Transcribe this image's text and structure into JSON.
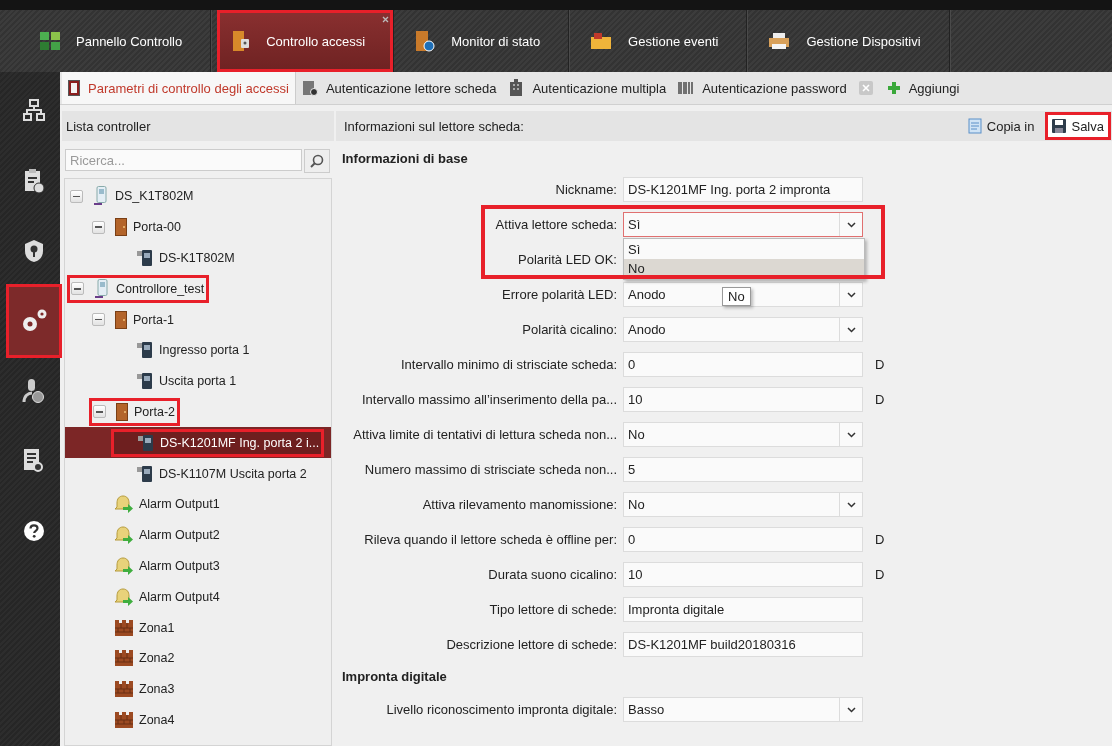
{
  "top_tabs": [
    {
      "label": "Pannello Controllo",
      "kind": "dashboard",
      "selected": false,
      "highlighted": false
    },
    {
      "label": "Controllo accessi",
      "kind": "access",
      "selected": true,
      "highlighted": true
    },
    {
      "label": "Monitor di stato",
      "kind": "monitor",
      "selected": false,
      "highlighted": false
    },
    {
      "label": "Gestione eventi",
      "kind": "events",
      "selected": false,
      "highlighted": false
    },
    {
      "label": "Gestione Dispositivi",
      "kind": "devices",
      "selected": false,
      "highlighted": false
    }
  ],
  "side_rail": [
    {
      "kind": "network",
      "selected": false,
      "highlighted": false
    },
    {
      "kind": "schedule",
      "selected": false,
      "highlighted": false
    },
    {
      "kind": "shield",
      "selected": false,
      "highlighted": false
    },
    {
      "kind": "settings",
      "selected": true,
      "highlighted": true
    },
    {
      "kind": "person",
      "selected": false,
      "highlighted": false
    },
    {
      "kind": "report",
      "selected": false,
      "highlighted": false
    },
    {
      "kind": "help",
      "selected": false,
      "highlighted": false
    }
  ],
  "sub_tabs": [
    {
      "label": "Parametri di controllo degli accessi",
      "kind": "door",
      "selected": true,
      "closable": false
    },
    {
      "label": "Autenticazione lettore scheda",
      "kind": "reader",
      "selected": false,
      "closable": false
    },
    {
      "label": "Autenticazione multipla",
      "kind": "multi",
      "selected": false,
      "closable": false
    },
    {
      "label": "Autenticazione password",
      "kind": "barcode",
      "selected": false,
      "closable": true
    }
  ],
  "add_tab": {
    "label": "Aggiungi"
  },
  "left_panel": {
    "title": "Lista controller",
    "search": {
      "placeholder": "Ricerca..."
    },
    "tree": [
      {
        "label": "DS_K1T802M",
        "kind": "controller",
        "expanded": true,
        "selected": false,
        "highlighted": false,
        "children": [
          {
            "label": "Porta-00",
            "kind": "door",
            "expanded": true,
            "selected": false,
            "highlighted": false,
            "children": [
              {
                "label": "DS-K1T802M",
                "kind": "reader",
                "selected": false,
                "highlighted": false
              }
            ]
          }
        ]
      },
      {
        "label": "Controllore_test",
        "kind": "controller",
        "expanded": true,
        "selected": false,
        "highlighted": true,
        "children": [
          {
            "label": "Porta-1",
            "kind": "door",
            "expanded": true,
            "selected": false,
            "highlighted": false,
            "children": [
              {
                "label": "Ingresso porta 1",
                "kind": "reader",
                "selected": false,
                "highlighted": false
              },
              {
                "label": "Uscita porta 1",
                "kind": "reader",
                "selected": false,
                "highlighted": false
              }
            ]
          },
          {
            "label": "Porta-2",
            "kind": "door",
            "expanded": true,
            "selected": false,
            "highlighted": true,
            "children": [
              {
                "label": "DS-K1201MF Ing. porta 2 i...",
                "kind": "reader",
                "selected": true,
                "highlighted": true
              },
              {
                "label": "DS-K1107M Uscita porta 2",
                "kind": "reader",
                "selected": false,
                "highlighted": false
              }
            ]
          },
          {
            "label": "Alarm Output1",
            "kind": "alarm",
            "selected": false,
            "highlighted": false
          },
          {
            "label": "Alarm Output2",
            "kind": "alarm",
            "selected": false,
            "highlighted": false
          },
          {
            "label": "Alarm Output3",
            "kind": "alarm",
            "selected": false,
            "highlighted": false
          },
          {
            "label": "Alarm Output4",
            "kind": "alarm",
            "selected": false,
            "highlighted": false
          },
          {
            "label": "Zona1",
            "kind": "zone",
            "selected": false,
            "highlighted": false
          },
          {
            "label": "Zona2",
            "kind": "zone",
            "selected": false,
            "highlighted": false
          },
          {
            "label": "Zona3",
            "kind": "zone",
            "selected": false,
            "highlighted": false
          },
          {
            "label": "Zona4",
            "kind": "zone",
            "selected": false,
            "highlighted": false
          }
        ]
      }
    ]
  },
  "right_panel": {
    "title": "Informazioni sul lettore scheda:",
    "copy_button": {
      "label": "Copia in"
    },
    "save_button": {
      "label": "Salva",
      "highlighted": true
    },
    "sections": [
      {
        "title": "Informazioni di base",
        "fields": [
          {
            "kind": "text",
            "label": "Nickname:",
            "value": "DS-K1201MF Ing. porta 2 impronta"
          },
          {
            "kind": "select",
            "label": "Attiva lettore scheda:",
            "value": "Sì",
            "focused": true,
            "highlighted": true,
            "open": true,
            "options": [
              {
                "label": "Sì",
                "hovered": false
              },
              {
                "label": "No",
                "hovered": true
              }
            ]
          },
          {
            "kind": "select",
            "label": "Polarità LED OK:"
          },
          {
            "kind": "select",
            "label": "Errore polarità LED:",
            "value": "Anodo",
            "tooltip": "No"
          },
          {
            "kind": "select",
            "label": "Polarità cicalino:",
            "value": "Anodo"
          },
          {
            "kind": "text",
            "label": "Intervallo minimo di strisciate scheda:",
            "value": "0",
            "unit": "D"
          },
          {
            "kind": "text",
            "label": "Intervallo massimo all’inserimento della pa...",
            "value": "10",
            "unit": "D"
          },
          {
            "kind": "select",
            "label": "Attiva limite di tentativi di lettura scheda non...",
            "value": "No"
          },
          {
            "kind": "text",
            "label": "Numero massimo di strisciate scheda non...",
            "value": "5"
          },
          {
            "kind": "select",
            "label": "Attiva rilevamento manomissione:",
            "value": "No"
          },
          {
            "kind": "text",
            "label": "Rileva quando il lettore scheda è offline per:",
            "value": "0",
            "unit": "D"
          },
          {
            "kind": "text",
            "label": "Durata suono cicalino:",
            "value": "10",
            "unit": "D"
          },
          {
            "kind": "text",
            "label": "Tipo lettore di schede:",
            "value": "Impronta digitale"
          },
          {
            "kind": "text",
            "label": "Descrizione lettore di schede:",
            "value": "DS-K1201MF build20180316"
          }
        ]
      },
      {
        "title": "Impronta digitale",
        "fields": [
          {
            "kind": "select",
            "label": "Livello riconoscimento impronta digitale:",
            "value": "Basso"
          }
        ]
      }
    ]
  }
}
